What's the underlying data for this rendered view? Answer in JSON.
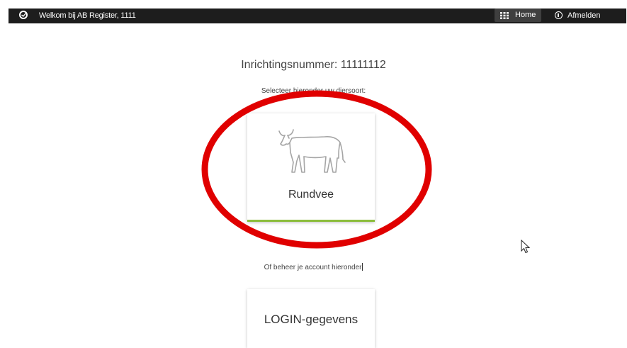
{
  "topbar": {
    "welcome": "Welkom bij AB Register, 1111",
    "home_label": "Home",
    "logout_label": "Afmelden"
  },
  "main": {
    "inrichtingsnummer": "Inrichtingsnummer: 11111112",
    "select_text": "Selecteer hieronder uw diersoort:",
    "species_card": {
      "label": "Rundvee",
      "icon": "cow-icon"
    },
    "manage_text": "Of beheer je account hieronder",
    "login_card": {
      "label": "LOGIN-gegevens"
    }
  },
  "colors": {
    "topbar": "#1d1d1d",
    "home_button": "#3f3f3f",
    "accent_green": "#8bbd3b",
    "annotation_red": "#e00000"
  }
}
